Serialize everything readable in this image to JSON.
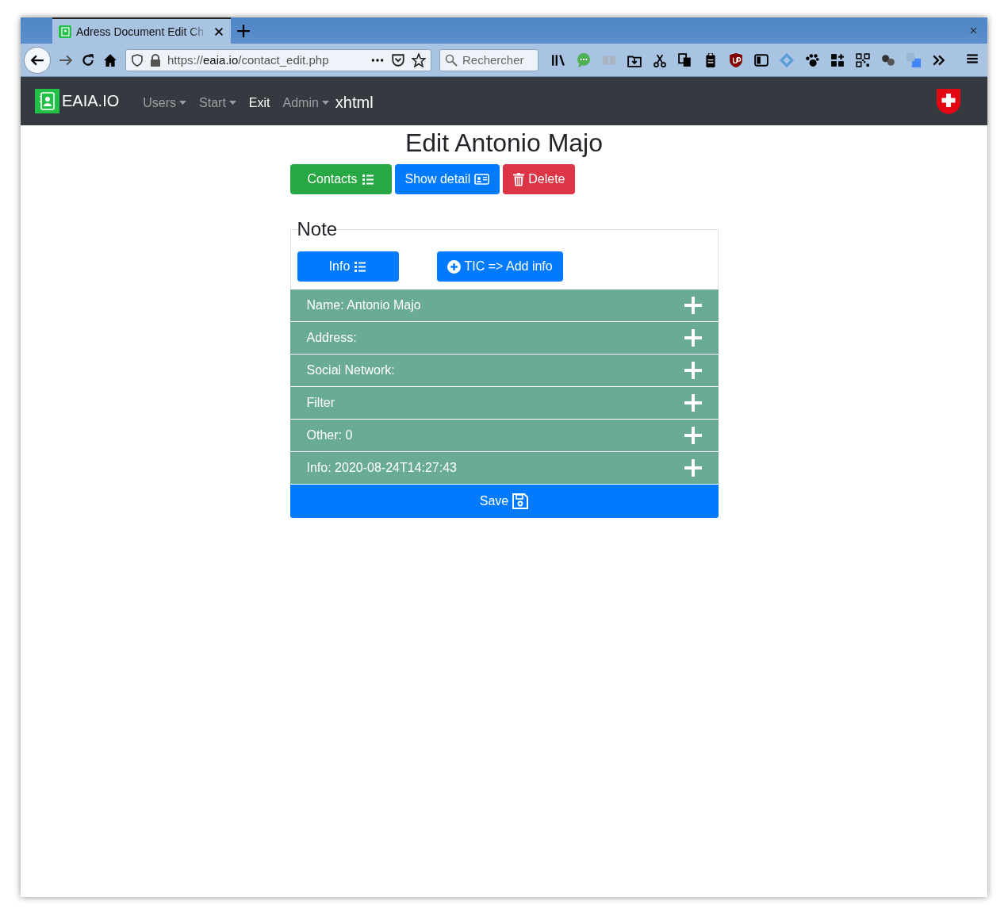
{
  "browser": {
    "tab": {
      "title": "Adress Document Edit Ch",
      "selected": true
    },
    "url": {
      "prefix": "https://",
      "host": "eaia.io",
      "path": "/contact_edit.php"
    },
    "search": {
      "placeholder": "Rechercher"
    }
  },
  "navbar": {
    "brand": "EAIA.IO",
    "items": [
      {
        "label": "Users",
        "dropdown": true,
        "active": false
      },
      {
        "label": "Start",
        "dropdown": true,
        "active": false
      },
      {
        "label": "Exit",
        "dropdown": false,
        "active": true
      },
      {
        "label": "Admin",
        "dropdown": true,
        "active": false
      }
    ],
    "text": "xhtml"
  },
  "title": "Edit Antonio Majo",
  "actions": [
    {
      "label": "Contacts",
      "kind": "success"
    },
    {
      "label": "Show detail",
      "kind": "primary"
    },
    {
      "label": "Delete",
      "kind": "danger"
    }
  ],
  "note": {
    "legend": "Note",
    "buttons": [
      {
        "label": "Info",
        "kind": "list"
      },
      {
        "label": "TIC => Add info",
        "kind": "add"
      }
    ]
  },
  "sections": [
    {
      "label": "Name: Antonio Majo",
      "expanded": false
    },
    {
      "label": "Address:",
      "expanded": false
    },
    {
      "label": "Social Network:",
      "expanded": false
    },
    {
      "label": "Filter",
      "expanded": false
    },
    {
      "label": "Other: 0",
      "expanded": false
    },
    {
      "label": "Info: 2020-08-24T14:27:43",
      "expanded": false
    }
  ],
  "save": "Save"
}
